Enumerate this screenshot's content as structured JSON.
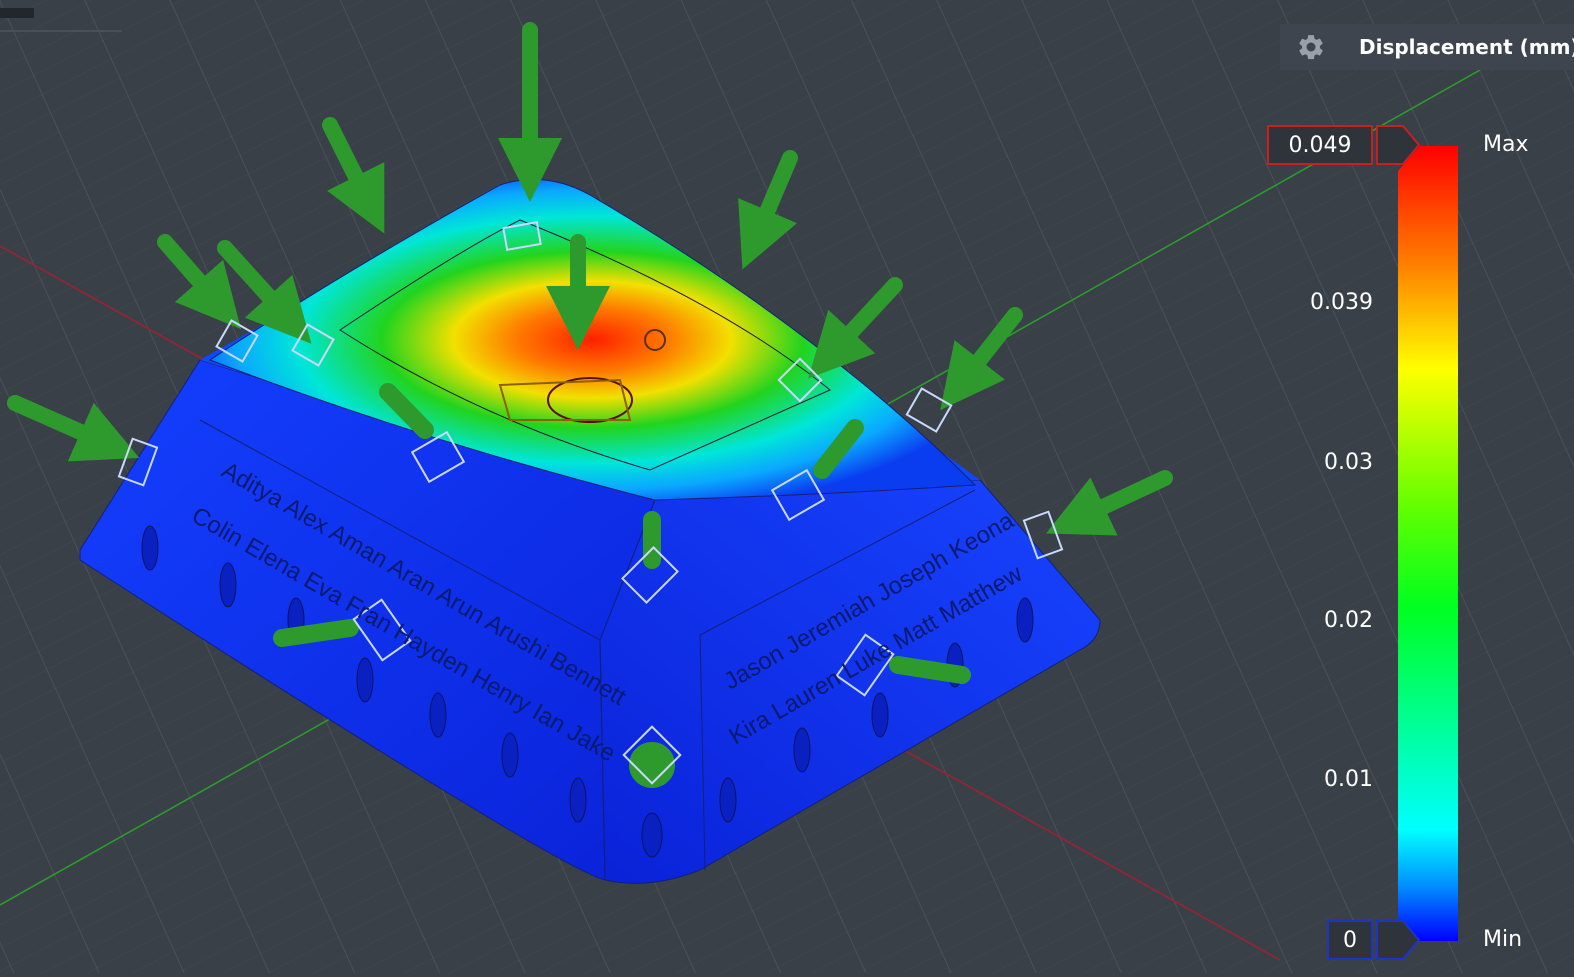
{
  "legend": {
    "title": "Displacement (mm)",
    "settings_icon": "gear-icon",
    "max_label": "Max",
    "min_label": "Min",
    "max_value": "0.049",
    "min_value": "0",
    "ticks": [
      "0.039",
      "0.03",
      "0.02",
      "0.01"
    ],
    "colors": {
      "max_box_border": "#c81e24",
      "min_box_border": "#1c34c8",
      "scale": [
        "#ff0000",
        "#ff8000",
        "#ffff00",
        "#00ff00",
        "#00ffff",
        "#0040ff",
        "#0000ff"
      ]
    }
  },
  "model": {
    "engraved_names_left": [
      "Aditya Alex Aman Aran Arun Arushi Bennett",
      "Colin Elena Eva Fran Hayden Henry Ian Jake"
    ],
    "engraved_names_right": [
      "Jason Jeremiah Joseph Keona",
      "Kira Lauren Luke Matt Matthew"
    ],
    "result_colors": {
      "low": "#0a2cf2",
      "mid": "#00e0ff",
      "high": "#ff2000"
    },
    "load_arrow_color": "#2e9a2e"
  }
}
